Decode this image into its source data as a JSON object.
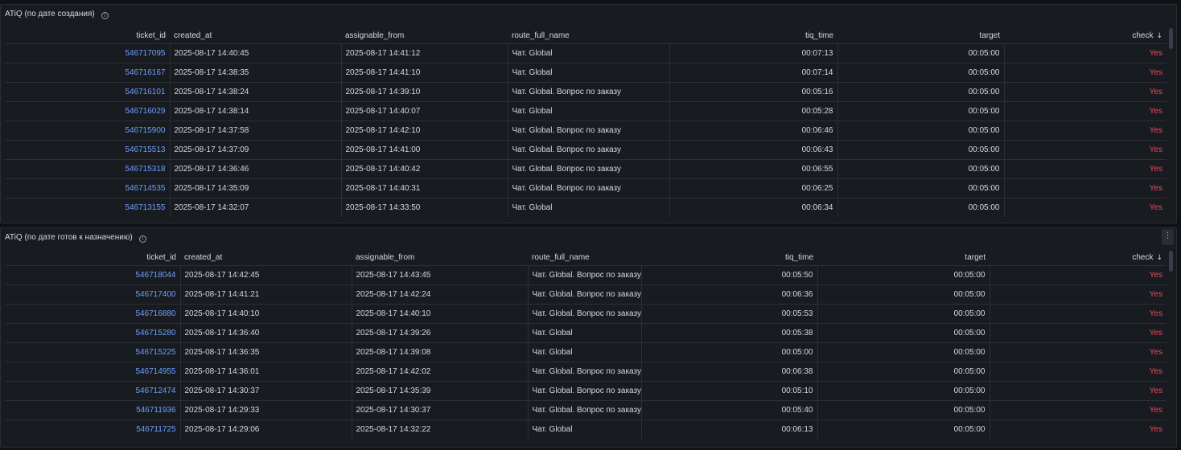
{
  "panels": [
    {
      "title": "ATiQ (по дате создания)",
      "columns": {
        "ticket_id": "ticket_id",
        "created_at": "created_at",
        "assignable_from": "assignable_from",
        "route_full_name": "route_full_name",
        "tiq_time": "tiq_time",
        "target": "target",
        "check": "check"
      },
      "rows": [
        [
          "546717095",
          "2025-08-17 14:40:45",
          "2025-08-17 14:41:12",
          "Чат. Global",
          "00:07:13",
          "00:05:00",
          "Yes"
        ],
        [
          "546716167",
          "2025-08-17 14:38:35",
          "2025-08-17 14:41:10",
          "Чат. Global",
          "00:07:14",
          "00:05:00",
          "Yes"
        ],
        [
          "546716101",
          "2025-08-17 14:38:24",
          "2025-08-17 14:39:10",
          "Чат. Global. Вопрос по заказу",
          "00:05:16",
          "00:05:00",
          "Yes"
        ],
        [
          "546716029",
          "2025-08-17 14:38:14",
          "2025-08-17 14:40:07",
          "Чат. Global",
          "00:05:28",
          "00:05:00",
          "Yes"
        ],
        [
          "546715900",
          "2025-08-17 14:37:58",
          "2025-08-17 14:42:10",
          "Чат. Global. Вопрос по заказу",
          "00:06:46",
          "00:05:00",
          "Yes"
        ],
        [
          "546715513",
          "2025-08-17 14:37:09",
          "2025-08-17 14:41:00",
          "Чат. Global. Вопрос по заказу",
          "00:06:43",
          "00:05:00",
          "Yes"
        ],
        [
          "546715318",
          "2025-08-17 14:36:46",
          "2025-08-17 14:40:42",
          "Чат. Global. Вопрос по заказу",
          "00:06:55",
          "00:05:00",
          "Yes"
        ],
        [
          "546714535",
          "2025-08-17 14:35:09",
          "2025-08-17 14:40:31",
          "Чат. Global. Вопрос по заказу",
          "00:06:25",
          "00:05:00",
          "Yes"
        ],
        [
          "546713155",
          "2025-08-17 14:32:07",
          "2025-08-17 14:33:50",
          "Чат. Global",
          "00:06:34",
          "00:05:00",
          "Yes"
        ]
      ]
    },
    {
      "title": "ATiQ (по дате готов к назначению)",
      "menu_icon": "⋮",
      "columns": {
        "ticket_id": "ticket_id",
        "created_at": "created_at",
        "assignable_from": "assignable_from",
        "route_full_name": "route_full_name",
        "tiq_time": "tiq_time",
        "target": "target",
        "check": "check"
      },
      "rows": [
        [
          "546718044",
          "2025-08-17 14:42:45",
          "2025-08-17 14:43:45",
          "Чат. Global. Вопрос по заказу",
          "00:05:50",
          "00:05:00",
          "Yes"
        ],
        [
          "546717400",
          "2025-08-17 14:41:21",
          "2025-08-17 14:42:24",
          "Чат. Global. Вопрос по заказу",
          "00:06:36",
          "00:05:00",
          "Yes"
        ],
        [
          "546716880",
          "2025-08-17 14:40:10",
          "2025-08-17 14:40:10",
          "Чат. Global. Вопрос по заказу",
          "00:05:53",
          "00:05:00",
          "Yes"
        ],
        [
          "546715280",
          "2025-08-17 14:36:40",
          "2025-08-17 14:39:26",
          "Чат. Global",
          "00:05:38",
          "00:05:00",
          "Yes"
        ],
        [
          "546715225",
          "2025-08-17 14:36:35",
          "2025-08-17 14:39:08",
          "Чат. Global",
          "00:05:00",
          "00:05:00",
          "Yes"
        ],
        [
          "546714955",
          "2025-08-17 14:36:01",
          "2025-08-17 14:42:02",
          "Чат. Global. Вопрос по заказу",
          "00:06:38",
          "00:05:00",
          "Yes"
        ],
        [
          "546712474",
          "2025-08-17 14:30:37",
          "2025-08-17 14:35:39",
          "Чат. Global. Вопрос по заказу",
          "00:05:10",
          "00:05:00",
          "Yes"
        ],
        [
          "546711936",
          "2025-08-17 14:29:33",
          "2025-08-17 14:30:37",
          "Чат. Global. Вопрос по заказу",
          "00:05:40",
          "00:05:00",
          "Yes"
        ],
        [
          "546711725",
          "2025-08-17 14:29:06",
          "2025-08-17 14:32:22",
          "Чат. Global",
          "00:06:13",
          "00:05:00",
          "Yes"
        ]
      ]
    }
  ],
  "icons": {
    "info": "i",
    "sort_desc": "↓"
  },
  "colors": {
    "link": "#6e9fff",
    "alert": "#f2495c",
    "panel_bg": "#181b1f",
    "page_bg": "#111217"
  }
}
